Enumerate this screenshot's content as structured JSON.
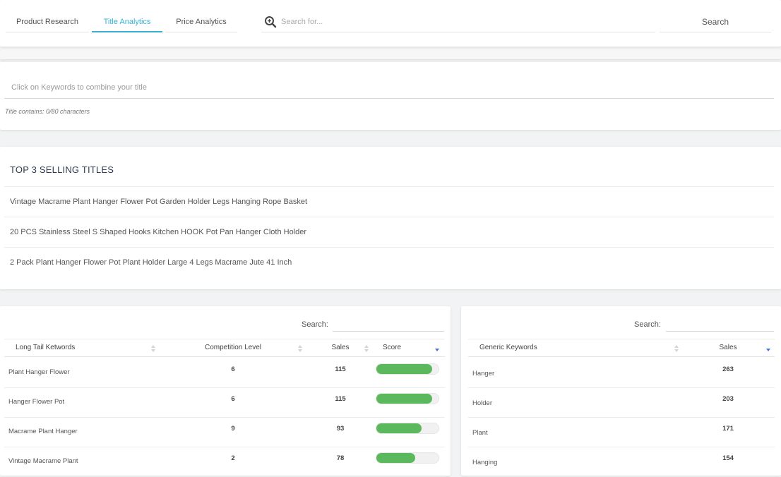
{
  "nav": {
    "tabs": [
      {
        "label": "Product Research",
        "active": false
      },
      {
        "label": "Title Analytics",
        "active": true
      },
      {
        "label": "Price Analytics",
        "active": false
      }
    ],
    "search_placeholder": "Search for...",
    "search_button": "Search"
  },
  "builder": {
    "placeholder": "Click on Keywords to combine your title",
    "char_count": "Title contains: 0/80 characters"
  },
  "top3": {
    "heading": "TOP 3 SELLING TITLES",
    "titles": [
      "Vintage Macrame Plant Hanger Flower Pot Garden Holder Legs Hanging Rope Basket",
      "20 PCS Stainless Steel S Shaped Hooks Kitchen HOOK Pot Pan Hanger Cloth Holder",
      "2 Pack Plant Hanger Flower Pot Plant Holder Large 4 Legs Macrame Jute 41 Inch"
    ]
  },
  "long_tail": {
    "search_label": "Search:",
    "headers": [
      "Long Tail Ketwords",
      "Competition Level",
      "Sales",
      "Score"
    ],
    "rows": [
      {
        "keyword": "Plant Hanger Flower",
        "competition": "6",
        "sales": "115",
        "score": 0.9
      },
      {
        "keyword": "Hanger Flower Pot",
        "competition": "6",
        "sales": "115",
        "score": 0.9
      },
      {
        "keyword": "Macrame Plant Hanger",
        "competition": "9",
        "sales": "93",
        "score": 0.73
      },
      {
        "keyword": "Vintage Macrame Plant",
        "competition": "2",
        "sales": "78",
        "score": 0.62
      }
    ],
    "bar_color": "#5cb85c"
  },
  "generic": {
    "search_label": "Search:",
    "headers": [
      "Generic Keywords",
      "Sales"
    ],
    "rows": [
      {
        "keyword": "Hanger",
        "sales": "263"
      },
      {
        "keyword": "Holder",
        "sales": "203"
      },
      {
        "keyword": "Plant",
        "sales": "171"
      },
      {
        "keyword": "Hanging",
        "sales": "154"
      }
    ]
  },
  "colors": {
    "accent": "#38b2d2",
    "score_bar": "#5cb85c",
    "sort_active": "#4a6fd8"
  }
}
